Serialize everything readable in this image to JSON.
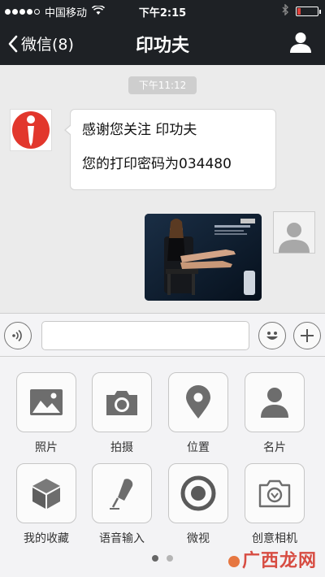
{
  "status_bar": {
    "carrier": "中国移动",
    "time": "下午2:15",
    "battery_level": 0.18,
    "battery_color": "#e0423c"
  },
  "nav": {
    "back_label": "微信(8)",
    "title": "印功夫",
    "profile_icon": "person-icon"
  },
  "chat": {
    "timestamp": "下午11:12",
    "incoming": {
      "line1": "感谢您关注 印功夫",
      "line2": "您的打印密码为034480"
    },
    "outgoing_image": "photo-message"
  },
  "input_bar": {
    "voice_icon": "voice-icon",
    "emoji_icon": "emoji-icon",
    "plus_icon": "plus-icon",
    "text_value": ""
  },
  "tools": [
    {
      "label": "照片",
      "icon": "image-icon"
    },
    {
      "label": "拍摄",
      "icon": "camera-icon"
    },
    {
      "label": "位置",
      "icon": "location-pin-icon"
    },
    {
      "label": "名片",
      "icon": "contact-card-icon"
    },
    {
      "label": "我的收藏",
      "icon": "cube-icon"
    },
    {
      "label": "语音输入",
      "icon": "microphone-icon"
    },
    {
      "label": "微视",
      "icon": "video-circle-icon"
    },
    {
      "label": "创意相机",
      "icon": "creative-camera-icon"
    }
  ],
  "pagination": {
    "current": 1,
    "total": 2
  },
  "watermark": "广西龙网"
}
